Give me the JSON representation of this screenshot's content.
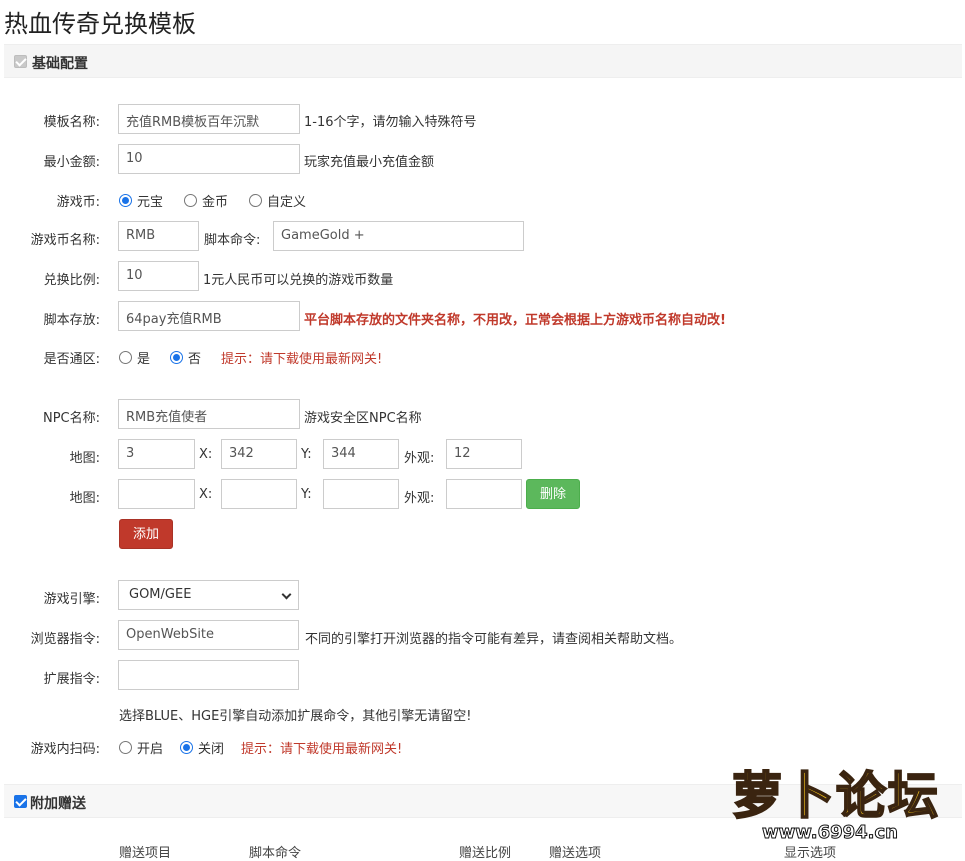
{
  "title": "热血传奇兑换模板",
  "basic": {
    "header": "基础配置",
    "template_name": {
      "label": "模板名称:",
      "value": "充值RMB模板百年沉默",
      "hint": "1-16个字，请勿输入特殊符号"
    },
    "min_amount": {
      "label": "最小金额:",
      "value": "10",
      "hint": "玩家充值最小充值金额"
    },
    "currency": {
      "label": "游戏币:",
      "options": [
        "元宝",
        "金币",
        "自定义"
      ],
      "selected": "元宝"
    },
    "currency_name": {
      "label": "游戏币名称:",
      "value": "RMB",
      "script_label": "脚本命令:",
      "script_value": "GameGold +"
    },
    "ratio": {
      "label": "兑换比例:",
      "value": "10",
      "hint": "1元人民币可以兑换的游戏币数量"
    },
    "script_store": {
      "label": "脚本存放:",
      "value": "64pay充值RMB",
      "hint": "平台脚本存放的文件夹名称，不用改，正常会根据上方游戏币名称自动改!"
    },
    "universal": {
      "label": "是否通区:",
      "options": [
        "是",
        "否"
      ],
      "selected": "否",
      "tip": "提示：请下载使用最新网关!"
    },
    "npc": {
      "label": "NPC名称:",
      "value": "RMB充值使者",
      "hint": "游戏安全区NPC名称"
    },
    "maps": [
      {
        "label": "地图:",
        "map": "3",
        "x_label": "X:",
        "x": "342",
        "y_label": "Y:",
        "y": "344",
        "look_label": "外观:",
        "look": "12"
      },
      {
        "label": "地图:",
        "map": "",
        "x_label": "X:",
        "x": "",
        "y_label": "Y:",
        "y": "",
        "look_label": "外观:",
        "look": "",
        "delete": "删除"
      }
    ],
    "add_button": "添加",
    "engine": {
      "label": "游戏引擎:",
      "value": "GOM/GEE"
    },
    "browser": {
      "label": "浏览器指令:",
      "value": "OpenWebSite",
      "hint": "不同的引擎打开浏览器的指令可能有差异，请查阅相关帮助文档。"
    },
    "extend": {
      "label": "扩展指令:",
      "value": "",
      "hint": "选择BLUE、HGE引擎自动添加扩展命令，其他引擎无请留空!"
    },
    "scan": {
      "label": "游戏内扫码:",
      "options": [
        "开启",
        "关闭"
      ],
      "selected": "关闭",
      "tip": "提示：请下载使用最新网关!"
    }
  },
  "bonus": {
    "header": "附加赠送",
    "columns": [
      "赠送项目",
      "脚本命令",
      "赠送比例",
      "赠送选项",
      "显示选项"
    ]
  },
  "watermark": {
    "brand": "萝卜论坛",
    "url": "www.6994.cn"
  },
  "colors": {
    "accent": "#1a73e8",
    "danger": "#c0392b",
    "success": "#5cb85c"
  }
}
